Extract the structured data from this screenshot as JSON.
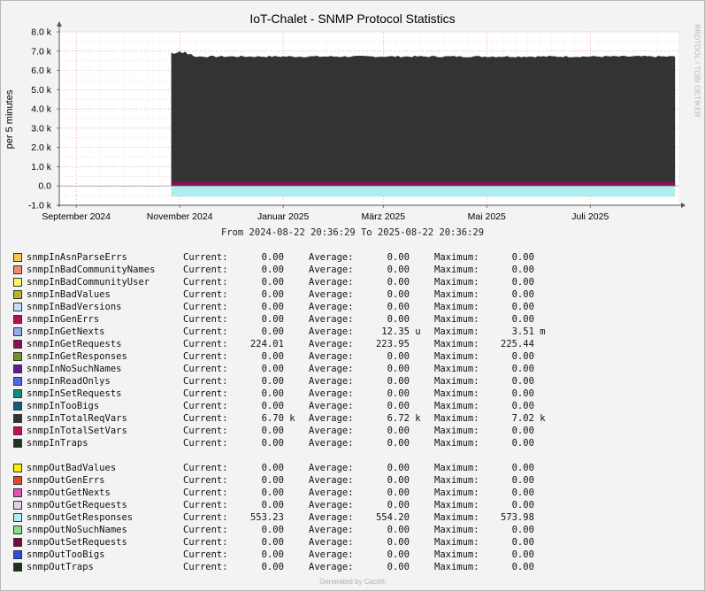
{
  "title": "IoT-Chalet - SNMP Protocol Statistics",
  "watermark": "RRDTOOL / TOBI OETIKER",
  "range_text": "From 2024-08-22 20:36:29 To 2025-08-22 20:36:29",
  "footer": "Generated by Cacti®",
  "chart_data": {
    "type": "area",
    "ylabel": "per 5 minutes",
    "ylim": [
      -1000,
      8000
    ],
    "y_ticks": [
      {
        "v": 8000,
        "label": "8.0 k"
      },
      {
        "v": 7000,
        "label": "7.0 k"
      },
      {
        "v": 6000,
        "label": "6.0 k"
      },
      {
        "v": 5000,
        "label": "5.0 k"
      },
      {
        "v": 4000,
        "label": "4.0 k"
      },
      {
        "v": 3000,
        "label": "3.0 k"
      },
      {
        "v": 2000,
        "label": "2.0 k"
      },
      {
        "v": 1000,
        "label": "1.0 k"
      },
      {
        "v": 0,
        "label": "0.0"
      },
      {
        "v": -1000,
        "label": "-1.0 k"
      }
    ],
    "x_range": [
      "2024-08-22",
      "2025-08-22"
    ],
    "x_ticks": [
      {
        "date": "2024-09-01",
        "label": "September 2024"
      },
      {
        "date": "2024-11-01",
        "label": "November 2024"
      },
      {
        "date": "2025-01-01",
        "label": "Januar 2025"
      },
      {
        "date": "2025-03-01",
        "label": "März 2025"
      },
      {
        "date": "2025-05-01",
        "label": "Mai 2025"
      },
      {
        "date": "2025-07-01",
        "label": "Juli 2025"
      }
    ],
    "data_start": "2024-10-27",
    "data_end": "2025-08-20",
    "series_drawn": [
      {
        "name": "snmpInTotalReqVars",
        "value": 6720,
        "max": 7020,
        "color": "#333333"
      },
      {
        "name": "snmpInGetRequests",
        "value": 224.01,
        "color": "#8C0F52"
      },
      {
        "name": "snmpOutGetResponses",
        "value": -553.23,
        "color": "#AEEEEE"
      }
    ]
  },
  "legend": {
    "cur_label": "Current:",
    "avg_label": "Average:",
    "max_label": "Maximum:",
    "groups": [
      [
        {
          "name": "snmpInAsnParseErrs",
          "color": "#F5C856",
          "cur": "0.00",
          "avg": "0.00",
          "max": "0.00"
        },
        {
          "name": "snmpInBadCommunityNames",
          "color": "#F08C78",
          "cur": "0.00",
          "avg": "0.00",
          "max": "0.00"
        },
        {
          "name": "snmpInBadCommunityUser",
          "color": "#FAFA5A",
          "cur": "0.00",
          "avg": "0.00",
          "max": "0.00"
        },
        {
          "name": "snmpInBadValues",
          "color": "#B8B42A",
          "cur": "0.00",
          "avg": "0.00",
          "max": "0.00"
        },
        {
          "name": "snmpInBadVersions",
          "color": "#C8DCF5",
          "cur": "0.00",
          "avg": "0.00",
          "max": "0.00"
        },
        {
          "name": "snmpInGenErrs",
          "color": "#B4105A",
          "cur": "0.00",
          "avg": "0.00",
          "max": "0.00"
        },
        {
          "name": "snmpInGetNexts",
          "color": "#96AAE6",
          "cur": "0.00",
          "avg": "12.35 u",
          "max": "3.51 m"
        },
        {
          "name": "snmpInGetRequests",
          "color": "#8C0F52",
          "cur": "224.01",
          "avg": "223.95",
          "max": "225.44"
        },
        {
          "name": "snmpInGetResponses",
          "color": "#6E961E",
          "cur": "0.00",
          "avg": "0.00",
          "max": "0.00"
        },
        {
          "name": "snmpInNoSuchNames",
          "color": "#6E1496",
          "cur": "0.00",
          "avg": "0.00",
          "max": "0.00"
        },
        {
          "name": "snmpInReadOnlys",
          "color": "#5064E6",
          "cur": "0.00",
          "avg": "0.00",
          "max": "0.00"
        },
        {
          "name": "snmpInSetRequests",
          "color": "#148C78",
          "cur": "0.00",
          "avg": "0.00",
          "max": "0.00"
        },
        {
          "name": "snmpInTooBigs",
          "color": "#145A82",
          "cur": "0.00",
          "avg": "0.00",
          "max": "0.00"
        },
        {
          "name": "snmpInTotalReqVars",
          "color": "#333333",
          "cur": "6.70 k",
          "avg": "6.72 k",
          "max": "7.02 k"
        },
        {
          "name": "snmpInTotalSetVars",
          "color": "#C80A50",
          "cur": "0.00",
          "avg": "0.00",
          "max": "0.00"
        },
        {
          "name": "snmpInTraps",
          "color": "#1E321E",
          "cur": "0.00",
          "avg": "0.00",
          "max": "0.00"
        }
      ],
      [
        {
          "name": "snmpOutBadValues",
          "color": "#FAF000",
          "cur": "0.00",
          "avg": "0.00",
          "max": "0.00"
        },
        {
          "name": "snmpOutGenErrs",
          "color": "#E64628",
          "cur": "0.00",
          "avg": "0.00",
          "max": "0.00"
        },
        {
          "name": "snmpOutGetNexts",
          "color": "#E650B4",
          "cur": "0.00",
          "avg": "0.00",
          "max": "0.00"
        },
        {
          "name": "snmpOutGetRequests",
          "color": "#DCD2F0",
          "cur": "0.00",
          "avg": "0.00",
          "max": "0.00"
        },
        {
          "name": "snmpOutGetResponses",
          "color": "#AEEEEE",
          "cur": "553.23",
          "avg": "554.20",
          "max": "573.98"
        },
        {
          "name": "snmpOutNoSuchNames",
          "color": "#8CDC8C",
          "cur": "0.00",
          "avg": "0.00",
          "max": "0.00"
        },
        {
          "name": "snmpOutSetRequests",
          "color": "#7A0A3C",
          "cur": "0.00",
          "avg": "0.00",
          "max": "0.00"
        },
        {
          "name": "snmpOutTooBigs",
          "color": "#2850E6",
          "cur": "0.00",
          "avg": "0.00",
          "max": "0.00"
        },
        {
          "name": "snmpOutTraps",
          "color": "#1E321E",
          "cur": "0.00",
          "avg": "0.00",
          "max": "0.00"
        }
      ]
    ]
  }
}
